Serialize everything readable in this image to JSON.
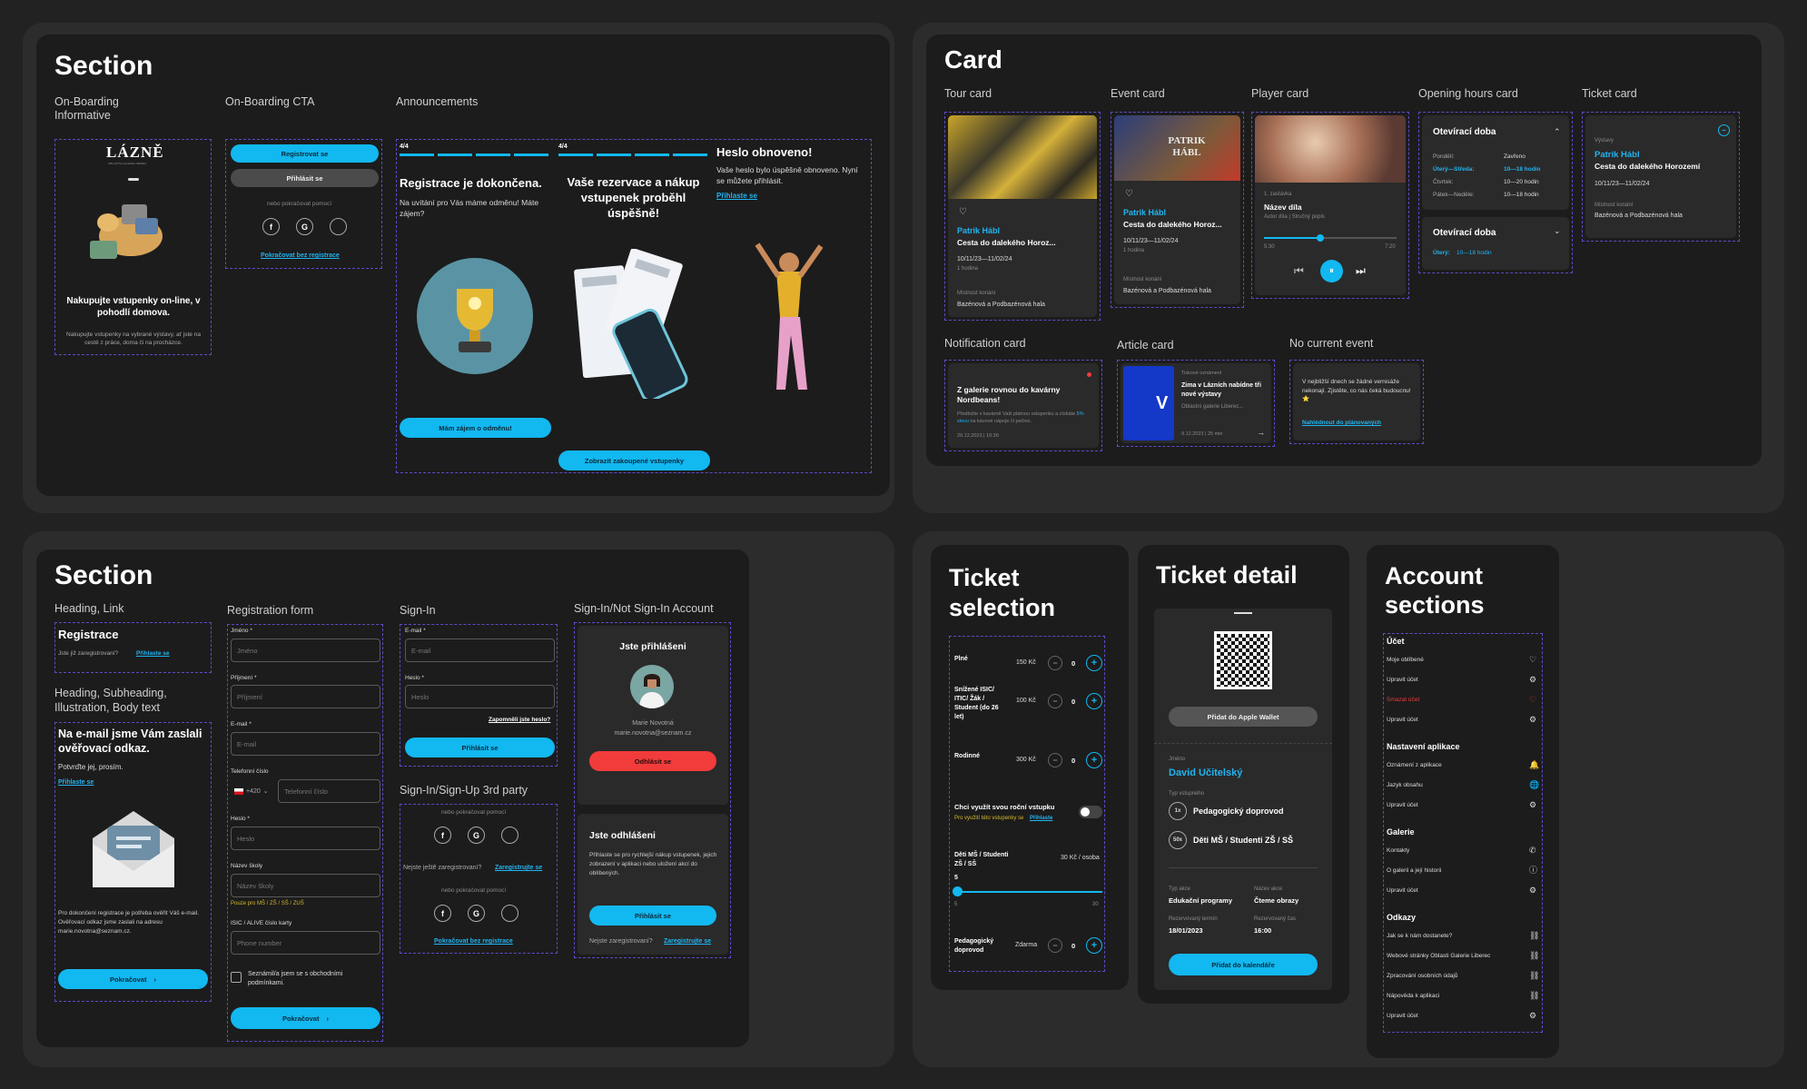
{
  "s1": {
    "title": "Section",
    "lab_ob": "On-Boarding\nInformative",
    "lab_cta": "On-Boarding CTA",
    "lab_ann": "Announcements",
    "ob": {
      "logo": "LÁZNĚ",
      "logo_sub": "OBLASTNÍ GALERIE LIBEREC",
      "headline": "Nakupujte vstupenky on-line, v pohodlí domova.",
      "body": "Nakupujte vstupenky na vybrané výstavy, ať jste na cestě z práce, doma či na procházce."
    },
    "cta": {
      "register": "Registrovat se",
      "login": "Přihlásit se",
      "or": "nebo pokračovat pomocí",
      "continue": "Pokračovat bez registrace"
    },
    "ann1": {
      "step": "4/4",
      "title": "Registrace je dokončena.",
      "body": "Na uvítání pro Vás máme odměnu! Máte zájem?",
      "btn": "Mám zájem o odměnu!"
    },
    "ann2": {
      "step": "4/4",
      "title": "Vaše rezervace a nákup vstupenek proběhl úspěšně!",
      "btn": "Zobrazit zakoupené vstupenky"
    },
    "ann3": {
      "title": "Heslo obnoveno!",
      "body": "Vaše heslo bylo úspěšně obnoveno. Nyní se můžete přihlásit.",
      "link": "Přihlaste se"
    }
  },
  "card": {
    "title": "Card",
    "lab_tour": "Tour card",
    "lab_event": "Event card",
    "lab_player": "Player card",
    "lab_hours": "Opening hours card",
    "lab_ticket": "Ticket card",
    "lab_notif": "Notification card",
    "lab_article": "Article card",
    "lab_nocur": "No current event",
    "tour": {
      "name": "Patrik Hábl",
      "title": "Cesta do dalekého Horoz...",
      "dates": "10/11/23—11/02/24",
      "dur": "1 hodina",
      "loc_l": "Místnost konání",
      "loc": "Bazénová a Podbazénová hala"
    },
    "event": {
      "img_text": "PATRIK HÁBL",
      "name": "Patrik Hábl",
      "title": "Cesta do dalekého Horoz...",
      "dates": "10/11/23—11/02/24",
      "dur": "1 hodina",
      "loc_l": "Místnost konání",
      "loc": "Bazénová a Podbazénová hala"
    },
    "player": {
      "stop": "1. zastávka",
      "title": "Název díla",
      "meta": "Autor díla | Stručný popis",
      "t0": "5:30",
      "t1": "7:20"
    },
    "hours": {
      "title": "Otevírací doba",
      "rows": [
        [
          "Pondělí:",
          "Zavřeno"
        ],
        [
          "Úterý—Středa:",
          "10—18 hodin"
        ],
        [
          "Čtvrtek:",
          "10—20 hodin"
        ],
        [
          "Pátek—Neděle:",
          "10—18 hodin"
        ]
      ],
      "title2": "Otevírací doba",
      "row2a": "Úterý:",
      "row2b": "10—18 hodin"
    },
    "ticket": {
      "l": "Výstavy",
      "name": "Patrik Hábl",
      "title": "Cesta do dalekého Horozemí",
      "dates": "10/11/23—11/02/24",
      "loc_l": "Místnost konání",
      "loc": "Bazénová a Podbazénová hala"
    },
    "notif": {
      "title": "Z galerie rovnou do kavárny Nordbeans!",
      "body1": "Předložte v kavárně Vaši platnou vstupenku a získáte ",
      "body_hl": "5% slevu",
      "body2": " na kávové nápoje či pečivo.",
      "date": "29.12.2023 | 10:30"
    },
    "article": {
      "cat": "Tiskové oznámení",
      "title": "Zima v Lázních nabídne tři nové výstavy",
      "sub": "Oblastní galerie Liberec...",
      "date": "9.12.2023 | 25 min",
      "img_big": "V"
    },
    "nocur": {
      "body": "V nejbližší dnech se žádné vernisáže nekonají. Zjistěte, co nás čeká budoucnu! ⭐",
      "link": "Nahlédnout do plánovaných"
    }
  },
  "s3": {
    "title": "Section",
    "lab_hl": "Heading, Link",
    "lab_hs": "Heading, Subheading,\nIllustration, Body text",
    "lab_reg": "Registration form",
    "lab_si": "Sign-In",
    "lab_si3": "Sign-In/Sign-Up 3rd party",
    "lab_acc": "Sign-In/Not Sign-In Account",
    "hl": {
      "title": "Registrace",
      "q": "Jste již zaregistrovaní?",
      "link": "Přihlaste se"
    },
    "hs": {
      "title": "Na e-mail jsme Vám zaslali ověřovací odkaz.",
      "sub": "Potvrďte jej, prosím.",
      "link": "Přihlaste se",
      "body": "Pro dokončení registrace je potřeba ověřit Váš e-mail. Ověřovací odkaz jsme zaslali na adresu marie.novotna@seznam.cz.",
      "btn": "Pokračovat"
    },
    "reg": {
      "l1": "Jméno",
      "p1": "Jméno",
      "l2": "Příjmení",
      "p2": "Příjmení",
      "l3": "E-mail",
      "p3": "E-mail",
      "l4": "Telefonní číslo",
      "pref": "+420",
      "p4": "Telefonní číslo",
      "l5": "Heslo",
      "p5": "Heslo",
      "l6": "Název školy",
      "p6": "Název školy",
      "hint": "Pouze pro MŠ / ZŠ / SŠ / ZUŠ",
      "l7": "ISIC / ALIVE číslo karty",
      "p7": "Phone number",
      "chk": "Seznámil/a jsem se s obchodními podmínkami.",
      "btn": "Pokračovat"
    },
    "si": {
      "l1": "E-mail",
      "p1": "E-mail",
      "l2": "Heslo",
      "p2": "Heslo",
      "forgot": "Zapomněli jste heslo?",
      "btn": "Přihlásit se"
    },
    "si3": {
      "or": "nebo pokračovat pomocí",
      "q": "Nejste ještě zaregistrovaní?",
      "link": "Zaregistrujte se",
      "or2": "nebo pokračovat pomocí",
      "cont": "Pokračovat bez registrace"
    },
    "acc": {
      "in_title": "Jste přihlášeni",
      "name": "Marie Novotná",
      "email": "marie.novotna@seznam.cz",
      "logout": "Odhlásit se",
      "out_title": "Jste odhlášeni",
      "out_body": "Přihlaste se pro rychlejší nákup vstupenek, jejich zobrazení v aplikaci nebo uložení akcí do oblíbených.",
      "login": "Přihlásit se",
      "q": "Nejste zaregistrovaní?",
      "link": "Zaregistrujte se"
    }
  },
  "ts": {
    "title": "Ticket\nselection",
    "rows": [
      {
        "n": "Plné",
        "p": "150 Kč",
        "c": "0"
      },
      {
        "n": "Snížené ISIC/ ITIC/ Žák / Student (do 26 let)",
        "p": "100 Kč",
        "c": "0"
      },
      {
        "n": "Rodinné",
        "p": "300 Kč",
        "c": "0"
      }
    ],
    "q": "Chci využít svou roční vstupku",
    "qs": "Pro využití této vstupenky se",
    "qlink": "Přihlaste",
    "kids": "Děti MŠ / Studenti ZŠ / SŠ",
    "kids_p": "30 Kč / osoba",
    "sl_v": "5",
    "sl_min": "5",
    "sl_max": "30",
    "ped": "Pedagogický doprovod",
    "ped_p": "Zdarma",
    "ped_c": "0"
  },
  "td": {
    "title": "Ticket detail",
    "wallet": "Přidat do Apple Wallet",
    "name_l": "Jméno",
    "name": "David Učitelský",
    "type_l": "Typ vstupného",
    "t1c": "1x",
    "t1": "Pedagogický doprovod",
    "t2c": "50x",
    "t2": "Děti MŠ / Studenti ZŠ / SŠ",
    "a_l": "Typ akce",
    "a": "Edukační programy",
    "b_l": "Název akce",
    "b": "Čteme obrazy",
    "c_l": "Rezervovaný termín",
    "c": "18/01/2023",
    "d_l": "Rezervovaný čas",
    "d": "16:00",
    "btn": "Přidat do kalendáře"
  },
  "as": {
    "title": "Account\nsections",
    "g1": "Účet",
    "g1i": [
      [
        "Moje oblíbené",
        "♡"
      ],
      [
        "Upravit účet",
        "⚙"
      ],
      [
        "Smazat účet",
        "♡"
      ],
      [
        "Upravit účet",
        "⚙"
      ]
    ],
    "g2": "Nastavení aplikace",
    "g2i": [
      [
        "Oznámení z aplikace",
        "🔔"
      ],
      [
        "Jazyk obsahu",
        "🌐"
      ],
      [
        "Upravit účet",
        "⚙"
      ]
    ],
    "g3": "Galerie",
    "g3i": [
      [
        "Kontakty",
        "✆"
      ],
      [
        "O galerii a její historii",
        "ⓘ"
      ],
      [
        "Upravit účet",
        "⚙"
      ]
    ],
    "g4": "Odkazy",
    "g4i": [
      [
        "Jak se k nám dostanete?",
        "⛓"
      ],
      [
        "Webové stránky Oblasti Galerie Liberec",
        "⛓"
      ],
      [
        "Zpracování osobních údajů",
        "⛓"
      ],
      [
        "Nápověda k aplikaci",
        "⛓"
      ],
      [
        "Upravit účet",
        "⚙"
      ]
    ]
  },
  "colors": {
    "accent": "#12b8f0",
    "danger": "#f23b3b",
    "dash": "#5d4bc8"
  }
}
